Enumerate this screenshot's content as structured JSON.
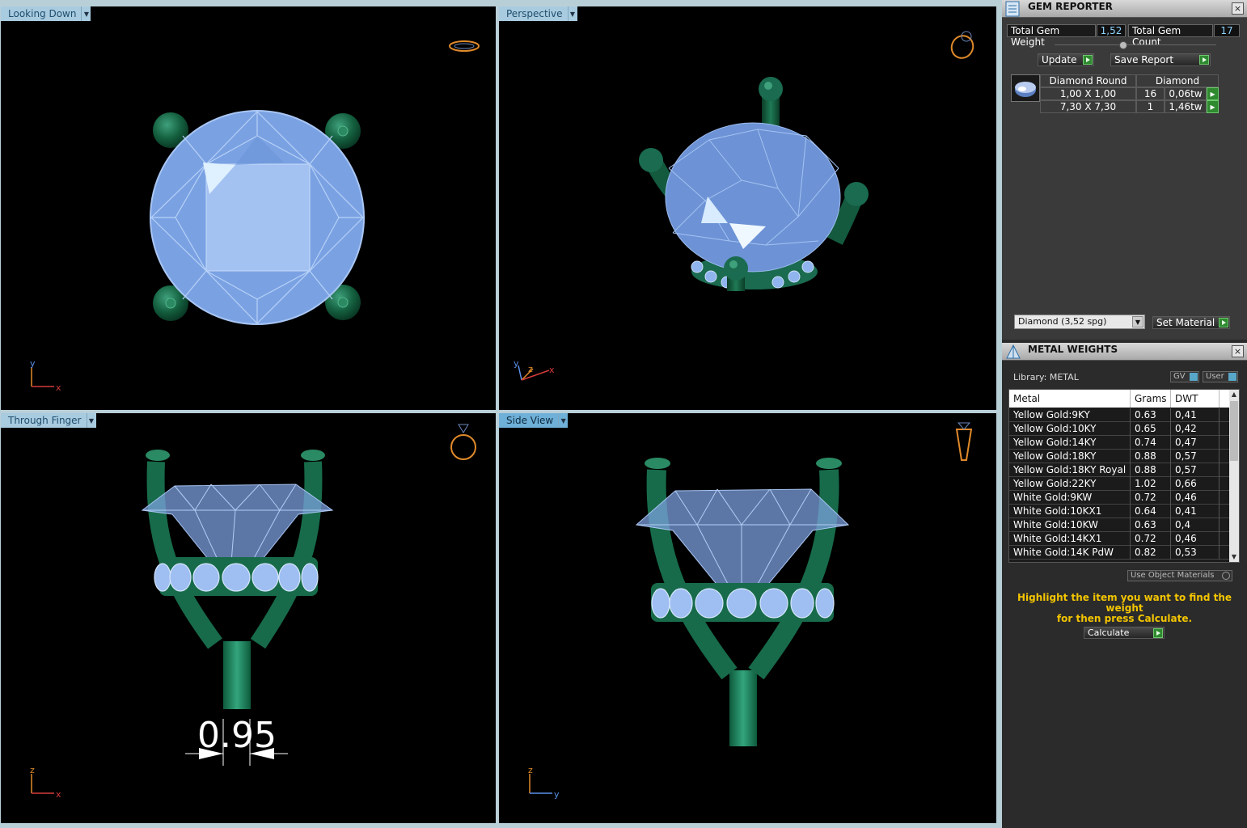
{
  "viewports": {
    "top": {
      "label": "Looking Down"
    },
    "perspective": {
      "label": "Perspective"
    },
    "front": {
      "label": "Through Finger",
      "dimension": "0.95"
    },
    "side": {
      "label": "Side View"
    }
  },
  "axes": {
    "top": {
      "a": "y",
      "b": "x"
    },
    "perspective": {
      "a": "y",
      "b": "z",
      "c": "x"
    },
    "front": {
      "a": "z",
      "b": "x"
    },
    "side": {
      "a": "z",
      "b": "y"
    }
  },
  "colors": {
    "metal": "#1a6b4f",
    "gem": "#8fb4ee",
    "accent": "#f3c500",
    "value": "#8fd3ff"
  },
  "gem_reporter": {
    "title": "GEM REPORTER",
    "total_weight_label": "Total Gem Weight",
    "total_weight": "1,52",
    "total_count_label": "Total Gem Count",
    "total_count": "17",
    "update_label": "Update",
    "save_report_label": "Save Report",
    "table": {
      "header_shape": "Diamond Round",
      "header_material": "Diamond",
      "rows": [
        {
          "size": "1,00 X 1,00",
          "count": "16",
          "weight": "0,06tw"
        },
        {
          "size": "7,30 X 7,30",
          "count": "1",
          "weight": "1,46tw"
        }
      ]
    },
    "material_select": "Diamond    (3,52 spg)",
    "set_material_label": "Set Material"
  },
  "metal_weights": {
    "title": "METAL WEIGHTS",
    "library": "Library: METAL",
    "gv_label": "GV",
    "user_label": "User",
    "headers": {
      "metal": "Metal",
      "grams": "Grams",
      "dwt": "DWT"
    },
    "rows": [
      {
        "metal": "Yellow Gold:9KY",
        "grams": "0.63",
        "dwt": "0,41"
      },
      {
        "metal": "Yellow Gold:10KY",
        "grams": "0.65",
        "dwt": "0,42"
      },
      {
        "metal": "Yellow Gold:14KY",
        "grams": "0.74",
        "dwt": "0,47"
      },
      {
        "metal": "Yellow Gold:18KY",
        "grams": "0.88",
        "dwt": "0,57"
      },
      {
        "metal": "Yellow Gold:18KY Royal",
        "grams": "0.88",
        "dwt": "0,57"
      },
      {
        "metal": "Yellow Gold:22KY",
        "grams": "1.02",
        "dwt": "0,66"
      },
      {
        "metal": "White Gold:9KW",
        "grams": "0.72",
        "dwt": "0,46"
      },
      {
        "metal": "White Gold:10KX1",
        "grams": "0.64",
        "dwt": "0,41"
      },
      {
        "metal": "White Gold:10KW",
        "grams": "0.63",
        "dwt": "0,4"
      },
      {
        "metal": "White Gold:14KX1",
        "grams": "0.72",
        "dwt": "0,46"
      },
      {
        "metal": "White Gold:14K PdW",
        "grams": "0.82",
        "dwt": "0,53"
      }
    ],
    "use_object_materials": "Use Object Materials",
    "hint_line1": "Highlight the item you want to find the weight",
    "hint_line2": "for then press Calculate.",
    "calculate_label": "Calculate"
  }
}
